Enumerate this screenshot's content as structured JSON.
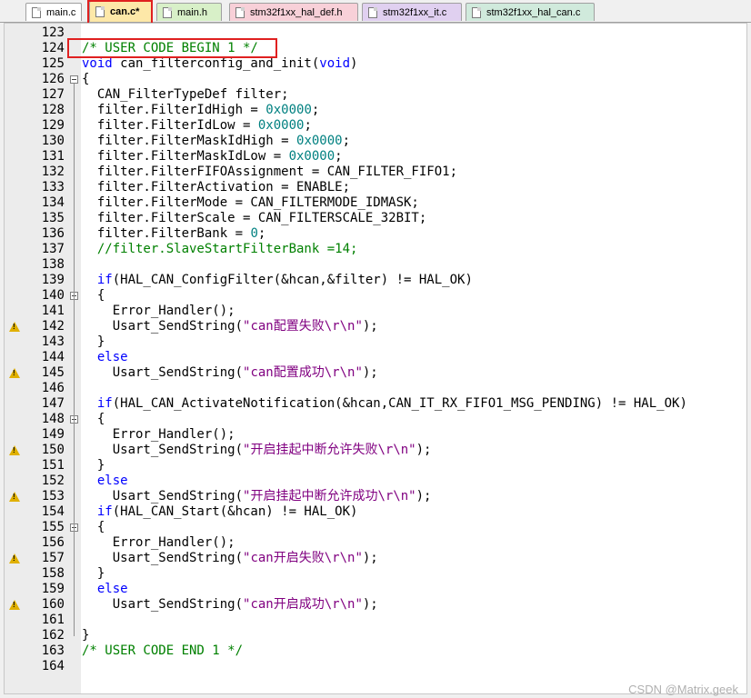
{
  "tabs": [
    {
      "label": "main.c",
      "color": "#ffffff",
      "active": false
    },
    {
      "label": "can.c*",
      "color": "#fde8a8",
      "active": true
    },
    {
      "label": "main.h",
      "color": "#d8f0c8",
      "active": false
    },
    {
      "label": "stm32f1xx_hal_def.h",
      "color": "#f8d0d8",
      "active": false
    },
    {
      "label": "stm32f1xx_it.c",
      "color": "#e0d0f0",
      "active": false
    },
    {
      "label": "stm32f1xx_hal_can.c",
      "color": "#d0eadc",
      "active": false
    }
  ],
  "watermark": "CSDN @Matrix.geek",
  "lines": [
    {
      "n": "123",
      "segs": [],
      "fold": false,
      "warn": false
    },
    {
      "n": "124",
      "segs": [
        {
          "t": "/* USER CODE BEGIN 1 */",
          "c": "comment"
        }
      ]
    },
    {
      "n": "125",
      "segs": [
        {
          "t": "void",
          "c": "kw"
        },
        {
          "t": " can_filterconfig_and_init(",
          "c": ""
        },
        {
          "t": "void",
          "c": "kw"
        },
        {
          "t": ")",
          "c": ""
        }
      ]
    },
    {
      "n": "126",
      "segs": [
        {
          "t": "{",
          "c": ""
        }
      ],
      "fold": true
    },
    {
      "n": "127",
      "segs": [
        {
          "t": "  CAN_FilterTypeDef filter;",
          "c": ""
        }
      ]
    },
    {
      "n": "128",
      "segs": [
        {
          "t": "  filter.FilterIdHigh = ",
          "c": ""
        },
        {
          "t": "0x0000",
          "c": "num"
        },
        {
          "t": ";",
          "c": ""
        }
      ]
    },
    {
      "n": "129",
      "segs": [
        {
          "t": "  filter.FilterIdLow = ",
          "c": ""
        },
        {
          "t": "0x0000",
          "c": "num"
        },
        {
          "t": ";",
          "c": ""
        }
      ]
    },
    {
      "n": "130",
      "segs": [
        {
          "t": "  filter.FilterMaskIdHigh = ",
          "c": ""
        },
        {
          "t": "0x0000",
          "c": "num"
        },
        {
          "t": ";",
          "c": ""
        }
      ]
    },
    {
      "n": "131",
      "segs": [
        {
          "t": "  filter.FilterMaskIdLow = ",
          "c": ""
        },
        {
          "t": "0x0000",
          "c": "num"
        },
        {
          "t": ";",
          "c": ""
        }
      ]
    },
    {
      "n": "132",
      "segs": [
        {
          "t": "  filter.FilterFIFOAssignment = CAN_FILTER_FIFO1;",
          "c": ""
        }
      ]
    },
    {
      "n": "133",
      "segs": [
        {
          "t": "  filter.FilterActivation = ENABLE;",
          "c": ""
        }
      ]
    },
    {
      "n": "134",
      "segs": [
        {
          "t": "  filter.FilterMode = CAN_FILTERMODE_IDMASK;",
          "c": ""
        }
      ]
    },
    {
      "n": "135",
      "segs": [
        {
          "t": "  filter.FilterScale = CAN_FILTERSCALE_32BIT;",
          "c": ""
        }
      ]
    },
    {
      "n": "136",
      "segs": [
        {
          "t": "  filter.FilterBank = ",
          "c": ""
        },
        {
          "t": "0",
          "c": "num"
        },
        {
          "t": ";",
          "c": ""
        }
      ]
    },
    {
      "n": "137",
      "segs": [
        {
          "t": "  //filter.SlaveStartFilterBank =14;",
          "c": "comment"
        }
      ]
    },
    {
      "n": "138",
      "segs": []
    },
    {
      "n": "139",
      "segs": [
        {
          "t": "  ",
          "c": ""
        },
        {
          "t": "if",
          "c": "kw"
        },
        {
          "t": "(HAL_CAN_ConfigFilter(&hcan,&filter) != HAL_OK)",
          "c": ""
        }
      ]
    },
    {
      "n": "140",
      "segs": [
        {
          "t": "  {",
          "c": ""
        }
      ],
      "fold": true
    },
    {
      "n": "141",
      "segs": [
        {
          "t": "    Error_Handler();",
          "c": ""
        }
      ]
    },
    {
      "n": "142",
      "segs": [
        {
          "t": "    Usart_SendString(",
          "c": ""
        },
        {
          "t": "\"can配置失败\\r\\n\"",
          "c": "str"
        },
        {
          "t": ");",
          "c": ""
        }
      ],
      "warn": true
    },
    {
      "n": "143",
      "segs": [
        {
          "t": "  }",
          "c": ""
        }
      ]
    },
    {
      "n": "144",
      "segs": [
        {
          "t": "  ",
          "c": ""
        },
        {
          "t": "else",
          "c": "kw"
        }
      ]
    },
    {
      "n": "145",
      "segs": [
        {
          "t": "    Usart_SendString(",
          "c": ""
        },
        {
          "t": "\"can配置成功\\r\\n\"",
          "c": "str"
        },
        {
          "t": ");",
          "c": ""
        }
      ],
      "warn": true
    },
    {
      "n": "146",
      "segs": []
    },
    {
      "n": "147",
      "segs": [
        {
          "t": "  ",
          "c": ""
        },
        {
          "t": "if",
          "c": "kw"
        },
        {
          "t": "(HAL_CAN_ActivateNotification(&hcan,CAN_IT_RX_FIFO1_MSG_PENDING) != HAL_OK)",
          "c": ""
        }
      ]
    },
    {
      "n": "148",
      "segs": [
        {
          "t": "  {",
          "c": ""
        }
      ],
      "fold": true
    },
    {
      "n": "149",
      "segs": [
        {
          "t": "    Error_Handler();",
          "c": ""
        }
      ]
    },
    {
      "n": "150",
      "segs": [
        {
          "t": "    Usart_SendString(",
          "c": ""
        },
        {
          "t": "\"开启挂起中断允许失败\\r\\n\"",
          "c": "str"
        },
        {
          "t": ");",
          "c": ""
        }
      ],
      "warn": true
    },
    {
      "n": "151",
      "segs": [
        {
          "t": "  }",
          "c": ""
        }
      ]
    },
    {
      "n": "152",
      "segs": [
        {
          "t": "  ",
          "c": ""
        },
        {
          "t": "else",
          "c": "kw"
        }
      ]
    },
    {
      "n": "153",
      "segs": [
        {
          "t": "    Usart_SendString(",
          "c": ""
        },
        {
          "t": "\"开启挂起中断允许成功\\r\\n\"",
          "c": "str"
        },
        {
          "t": ");",
          "c": ""
        }
      ],
      "warn": true
    },
    {
      "n": "154",
      "segs": [
        {
          "t": "  ",
          "c": ""
        },
        {
          "t": "if",
          "c": "kw"
        },
        {
          "t": "(HAL_CAN_Start(&hcan) != HAL_OK)",
          "c": ""
        }
      ]
    },
    {
      "n": "155",
      "segs": [
        {
          "t": "  {",
          "c": ""
        }
      ],
      "fold": true
    },
    {
      "n": "156",
      "segs": [
        {
          "t": "    Error_Handler();",
          "c": ""
        }
      ]
    },
    {
      "n": "157",
      "segs": [
        {
          "t": "    Usart_SendString(",
          "c": ""
        },
        {
          "t": "\"can开启失败\\r\\n\"",
          "c": "str"
        },
        {
          "t": ");",
          "c": ""
        }
      ],
      "warn": true
    },
    {
      "n": "158",
      "segs": [
        {
          "t": "  }",
          "c": ""
        }
      ]
    },
    {
      "n": "159",
      "segs": [
        {
          "t": "  ",
          "c": ""
        },
        {
          "t": "else",
          "c": "kw"
        }
      ]
    },
    {
      "n": "160",
      "segs": [
        {
          "t": "    Usart_SendString(",
          "c": ""
        },
        {
          "t": "\"can开启成功\\r\\n\"",
          "c": "str"
        },
        {
          "t": ");",
          "c": ""
        }
      ],
      "warn": true
    },
    {
      "n": "161",
      "segs": []
    },
    {
      "n": "162",
      "segs": [
        {
          "t": "}",
          "c": ""
        }
      ]
    },
    {
      "n": "163",
      "segs": [
        {
          "t": "/* USER CODE END 1 */",
          "c": "comment"
        }
      ]
    },
    {
      "n": "164",
      "segs": []
    }
  ]
}
